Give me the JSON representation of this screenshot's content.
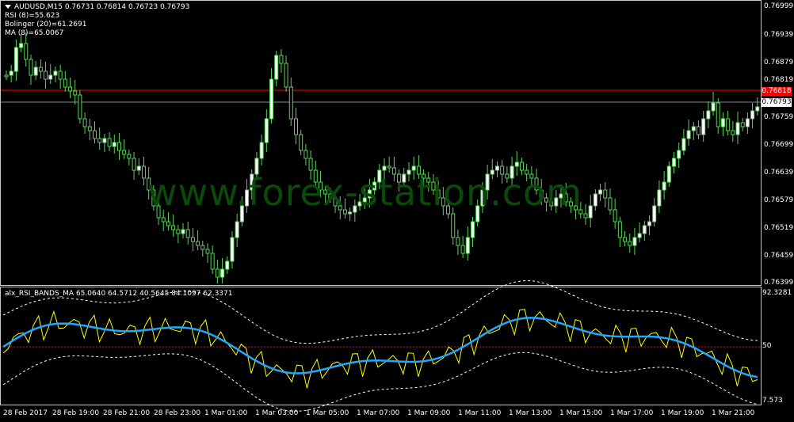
{
  "main_chart": {
    "symbol_line": "AUDUSD,M15  0.76731 0.76814 0.76723 0.76793",
    "indicators": [
      "RSI (8)=55.623",
      "Bolinger (20)=61.2691",
      "MA (8)=65.0067"
    ],
    "price_ticks": [
      "0.76999",
      "0.76939",
      "0.76879",
      "0.76819",
      "0.76759",
      "0.76699",
      "0.76639",
      "0.76579",
      "0.76519",
      "0.76459",
      "0.76399"
    ],
    "red_line_label": "0.76818",
    "current_price_label": "0.76793",
    "watermark": "www.forex-station.com",
    "colors": {
      "bull": "#000000",
      "bear": "#ffffff",
      "wick": "#5cd35c",
      "red_line": "#ff0000",
      "price_line": "#7f8c99"
    }
  },
  "indicator_pane": {
    "title": "alx_RSI_BANDS_MA 65.0640 64.5712 40.5645 84.1097 62.3371",
    "scale_top": "92.3281",
    "scale_mid": "50",
    "scale_bottom": "7.573",
    "colors": {
      "rsi": "#ffff00",
      "ma": "#1ea8ff",
      "bands": "#ffffff",
      "midline": "#c8141e"
    }
  },
  "time_axis": [
    "28 Feb 2017",
    "28 Feb 19:00",
    "28 Feb 21:00",
    "28 Feb 23:00",
    "1 Mar 01:00",
    "1 Mar 03:00",
    "1 Mar 05:00",
    "1 Mar 07:00",
    "1 Mar 09:00",
    "1 Mar 11:00",
    "1 Mar 13:00",
    "1 Mar 15:00",
    "1 Mar 17:00",
    "1 Mar 19:00",
    "1 Mar 21:00"
  ]
}
